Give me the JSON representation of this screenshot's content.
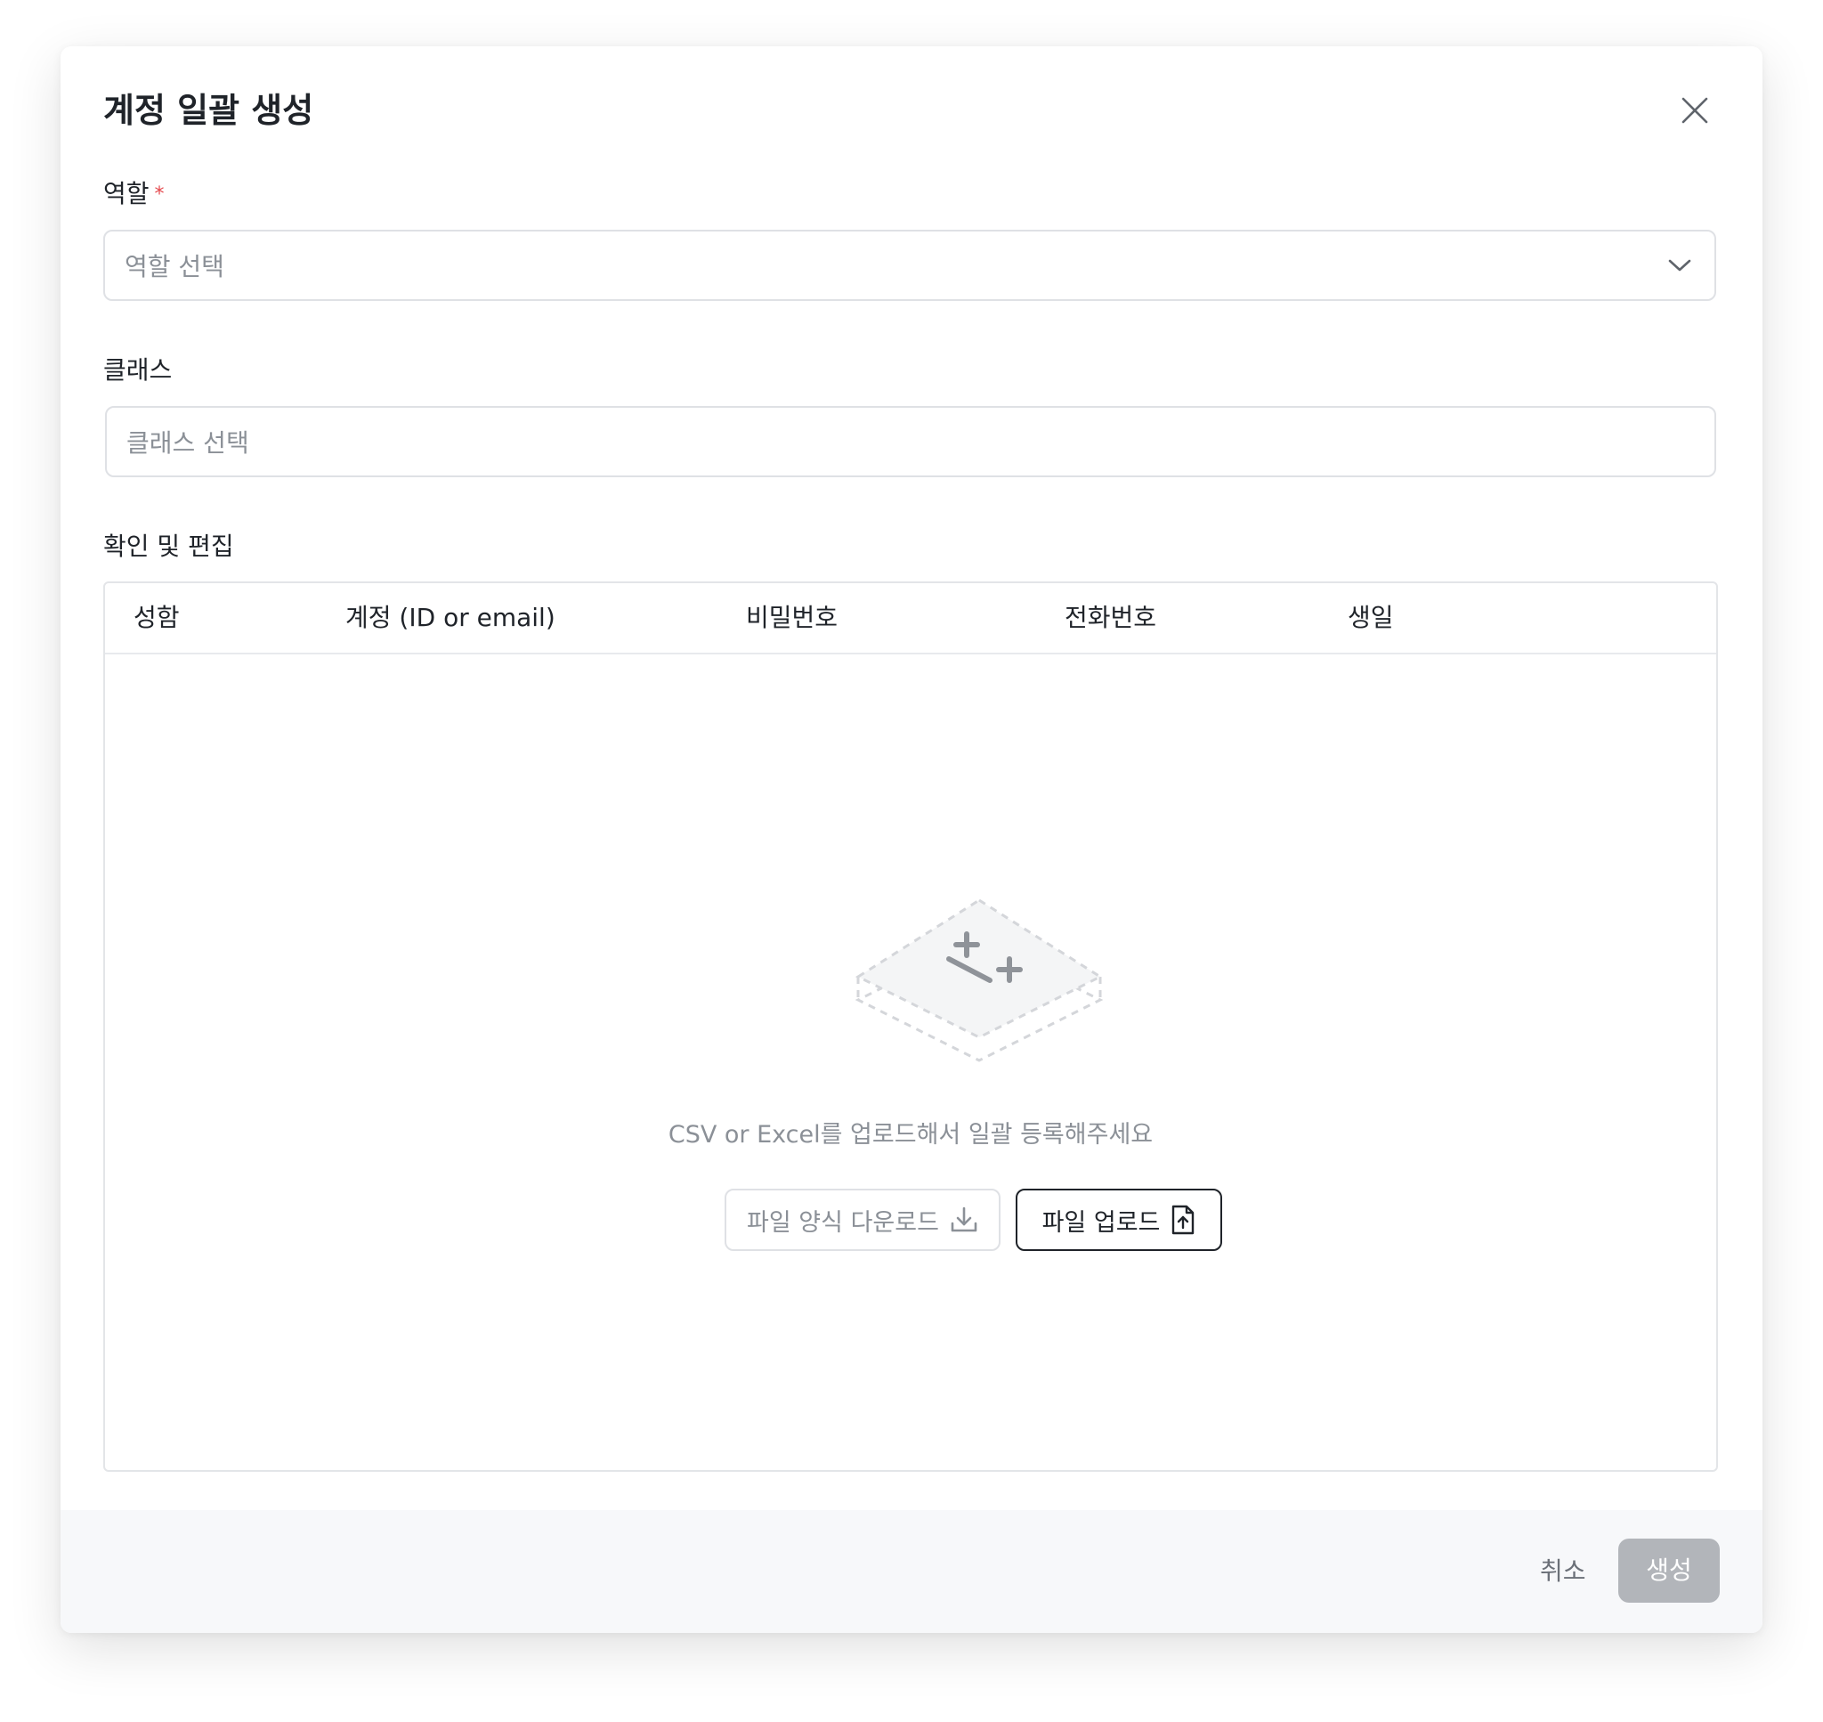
{
  "dialog": {
    "title": "계정 일괄 생성"
  },
  "role": {
    "label": "역할",
    "required_mark": "*",
    "placeholder": "역할 선택"
  },
  "class": {
    "label": "클래스",
    "placeholder": "클래스 선택"
  },
  "review": {
    "label": "확인 및 편집",
    "columns": [
      "성함",
      "계정 (ID or email)",
      "비밀번호",
      "전화번호",
      "생일"
    ],
    "empty_message": "CSV or Excel를 업로드해서 일괄 등록해주세요",
    "template_download_label": "파일 양식 다운로드",
    "upload_label": "파일 업로드"
  },
  "footer": {
    "cancel_label": "취소",
    "create_label": "생성"
  },
  "icons": {
    "close": "close-icon",
    "chevron": "chevron-down-icon",
    "download": "download-icon",
    "file_upload": "file-upload-icon",
    "empty": "empty-state-illustration"
  },
  "colors": {
    "required": "#e5484d",
    "disabled_button": "#b2b5ba",
    "footer_bg": "#f7f8fa"
  }
}
